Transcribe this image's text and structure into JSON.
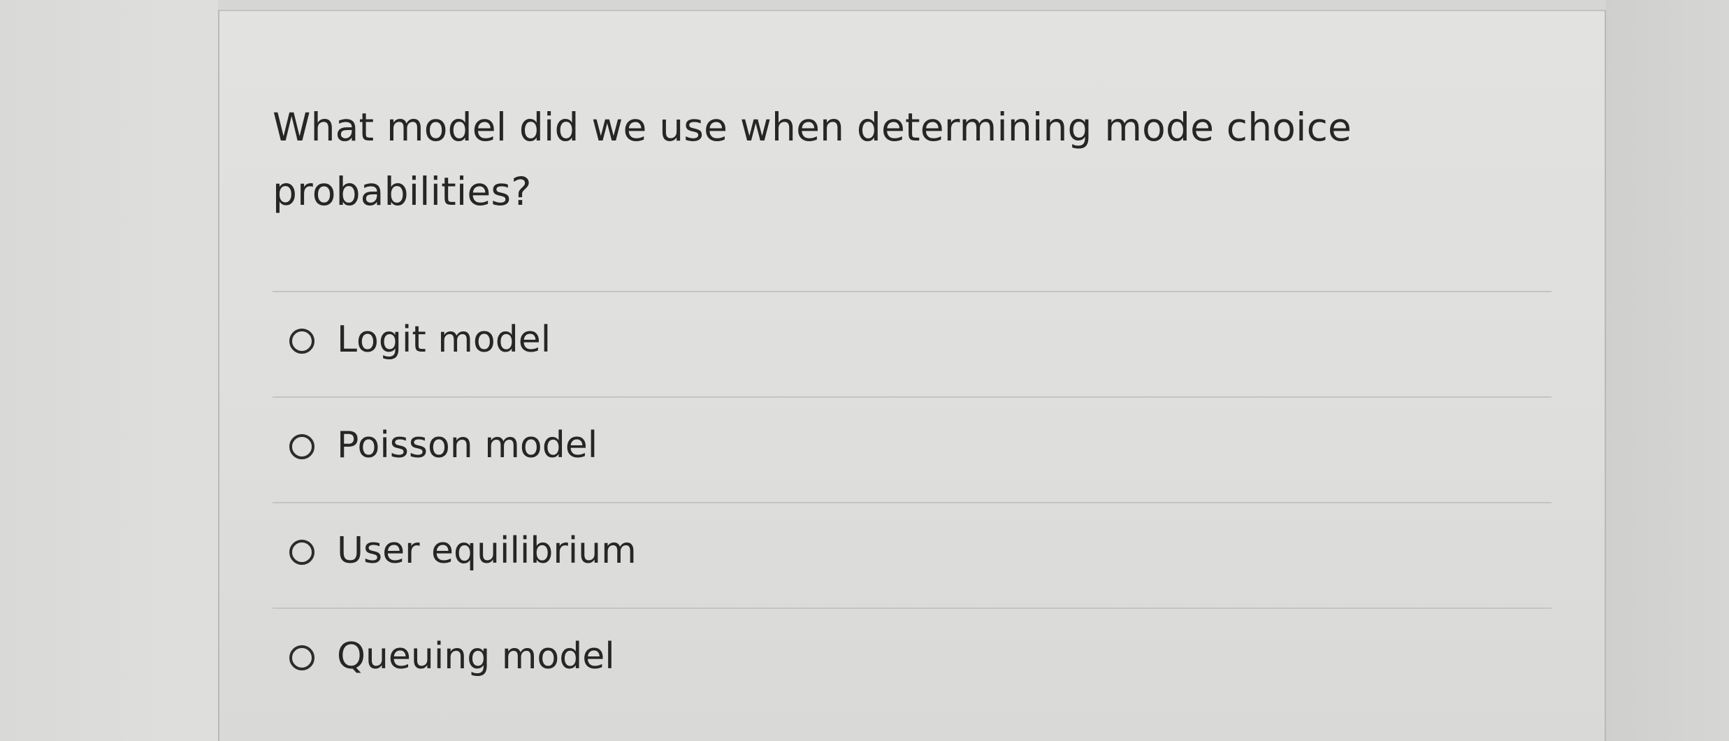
{
  "quiz": {
    "question": "What model did we use when determining mode choice probabilities?",
    "options": [
      {
        "label": "Logit model",
        "selected": false
      },
      {
        "label": "Poisson model",
        "selected": false
      },
      {
        "label": "User equilibrium",
        "selected": false
      },
      {
        "label": "Queuing model",
        "selected": false
      }
    ]
  },
  "colors": {
    "text": "#262626",
    "card_background": "#e0e0de",
    "divider": "#c4c4c2",
    "radio_border": "#2c2c2c"
  }
}
